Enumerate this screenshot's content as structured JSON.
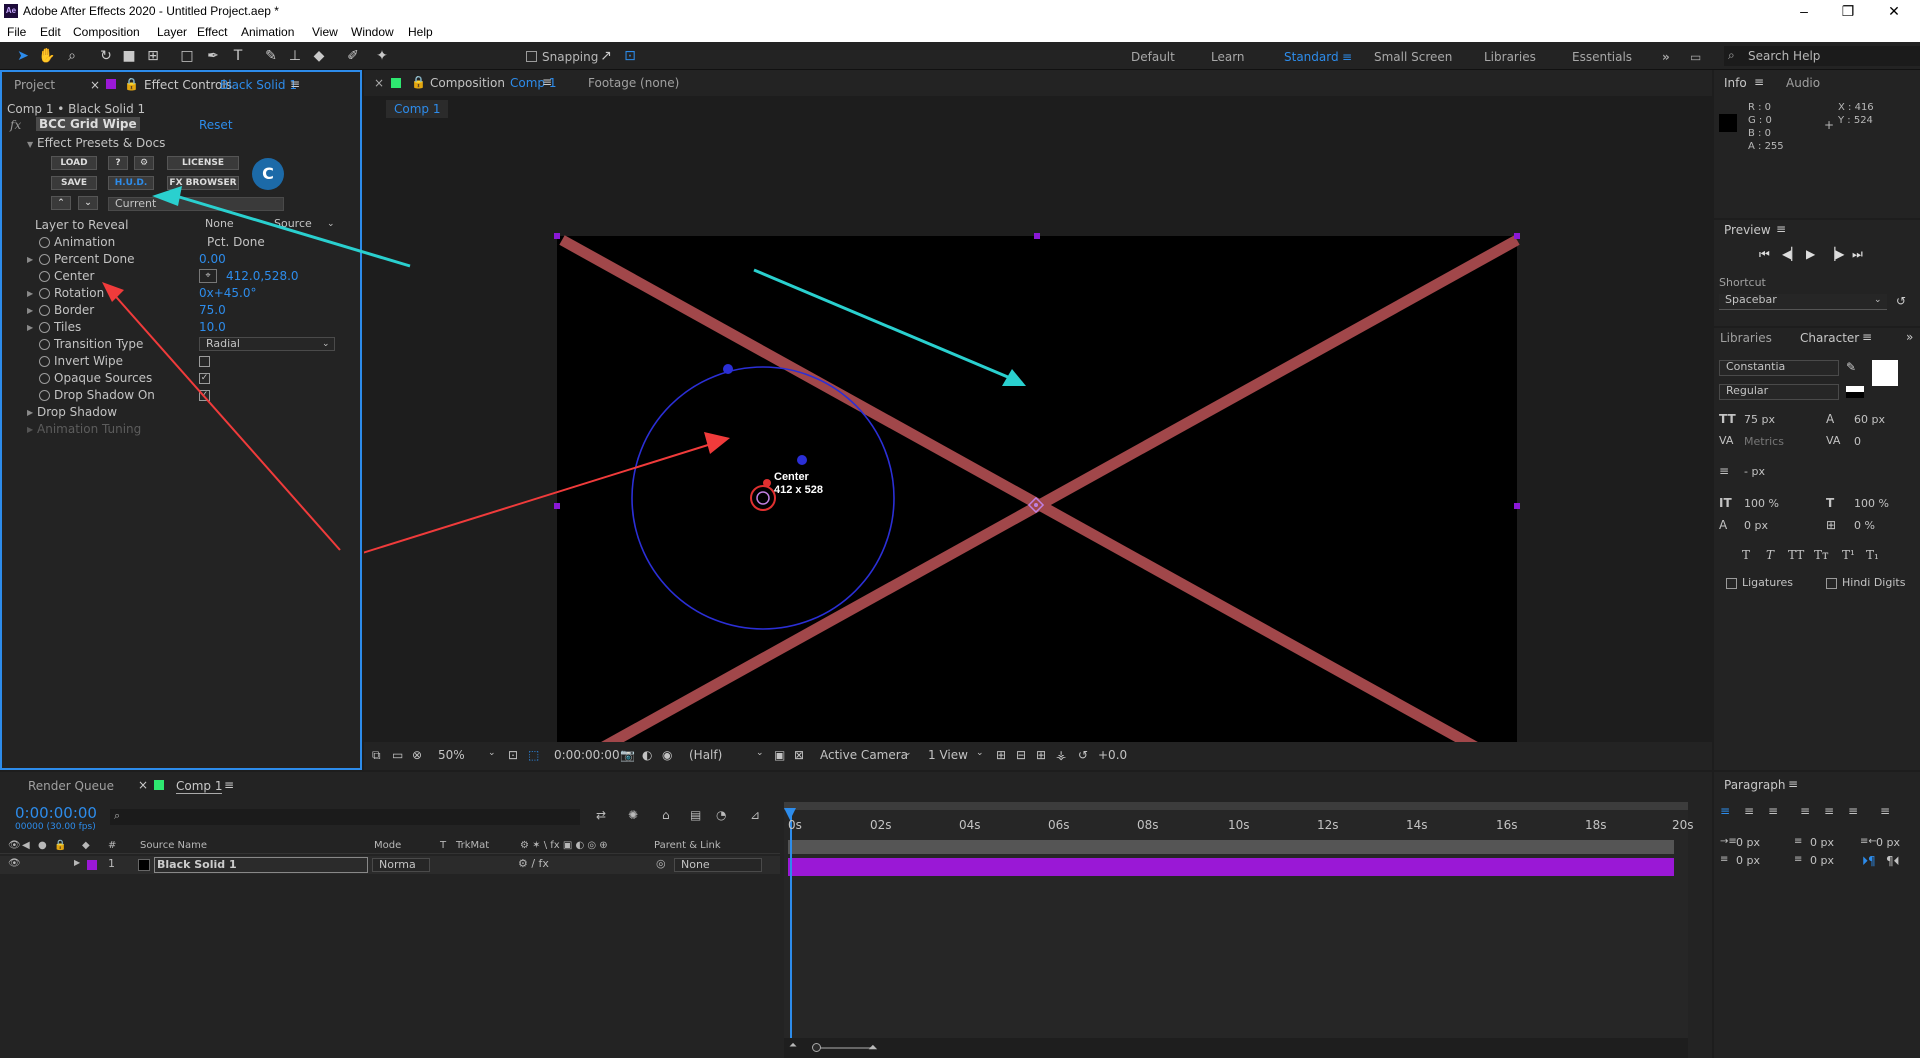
{
  "window": {
    "title": "Adobe After Effects 2020 - Untitled Project.aep *",
    "app_icon": "Ae"
  },
  "menu": [
    "File",
    "Edit",
    "Composition",
    "Layer",
    "Effect",
    "Animation",
    "View",
    "Window",
    "Help"
  ],
  "toolbar": {
    "snapping_label": "Snapping",
    "workspaces": [
      "Default",
      "Learn",
      "Standard",
      "Small Screen",
      "Libraries",
      "Essentials"
    ],
    "active_workspace": "Standard",
    "search_placeholder": "Search Help"
  },
  "project_panel": {
    "tab_project": "Project",
    "tab_effect_controls": "Effect Controls",
    "effect_controls_layer": "Black Solid 1",
    "breadcrumb": "Comp 1 • Black Solid 1",
    "effect_name": "BCC Grid Wipe",
    "reset_label": "Reset",
    "presets_label": "Effect Presets & Docs",
    "buttons": {
      "load": "LOAD",
      "help": "?",
      "license": "LICENSE",
      "save": "SAVE",
      "hud": "H.U.D.",
      "fx_browser": "FX BROWSER",
      "current": "Current",
      "logo": "C"
    },
    "properties": [
      {
        "label": "Layer to Reveal",
        "value": "None",
        "value2": "Source",
        "kind": "dropdown2"
      },
      {
        "label": "Animation",
        "value": "Pct. Done",
        "kind": "dropdown"
      },
      {
        "label": "Percent Done",
        "value": "0.00",
        "kind": "number"
      },
      {
        "label": "Center",
        "value": "412.0,528.0",
        "kind": "point"
      },
      {
        "label": "Rotation",
        "value": "0x+45.0°",
        "kind": "number"
      },
      {
        "label": "Border",
        "value": "75.0",
        "kind": "number"
      },
      {
        "label": "Tiles",
        "value": "10.0",
        "kind": "number"
      },
      {
        "label": "Transition Type",
        "value": "Radial",
        "kind": "dropdown"
      },
      {
        "label": "Invert Wipe",
        "checked": false,
        "kind": "checkbox"
      },
      {
        "label": "Opaque Sources",
        "checked": true,
        "kind": "checkbox"
      },
      {
        "label": "Drop Shadow On",
        "checked": true,
        "kind": "checkbox"
      },
      {
        "label": "Drop Shadow",
        "kind": "group"
      },
      {
        "label": "Animation Tuning",
        "kind": "group-disabled"
      }
    ]
  },
  "composition_panel": {
    "tab_label": "Composition",
    "tab_comp": "Comp 1",
    "footage_label": "Footage (none)",
    "sub_tab": "Comp 1",
    "center_label": "Center",
    "center_value": "412 x 528",
    "viewer_bar": {
      "zoom": "50%",
      "timecode": "0:00:00:00",
      "resolution": "(Half)",
      "camera": "Active Camera",
      "views": "1 View",
      "exposure": "+0.0"
    }
  },
  "info_panel": {
    "tab_info": "Info",
    "tab_audio": "Audio",
    "r": "R : 0",
    "g": "G : 0",
    "b": "B : 0",
    "a": "A : 255",
    "x": "X : 416",
    "y": "Y : 524"
  },
  "preview_panel": {
    "title": "Preview",
    "shortcut_label": "Shortcut",
    "shortcut_value": "Spacebar"
  },
  "character_panel": {
    "tab_libraries": "Libraries",
    "tab_character": "Character",
    "font": "Constantia",
    "style": "Regular",
    "size": "75 px",
    "leading": "60 px",
    "kerning": "Metrics",
    "tracking": "0",
    "stroke": "- px",
    "vscale": "100 %",
    "hscale": "100 %",
    "baseline": "0 px",
    "tsume": "0 %",
    "ligatures": "Ligatures",
    "hindi_digits": "Hindi Digits"
  },
  "paragraph_panel": {
    "title": "Paragraph",
    "indent_left": "0 px",
    "indent_first": "0 px",
    "indent_right": "0 px",
    "space_before": "0 px",
    "space_after": "0 px"
  },
  "timeline": {
    "tab_render_queue": "Render Queue",
    "tab_comp": "Comp 1",
    "timecode": "0:00:00:00",
    "frame_info": "00000 (30.00 fps)",
    "columns": {
      "source_name": "Source Name",
      "mode": "Mode",
      "t": "T",
      "trkmat": "TrkMat",
      "parent": "Parent & Link"
    },
    "layers": [
      {
        "index": "1",
        "name": "Black Solid 1",
        "mode": "Norma",
        "parent": "None"
      }
    ],
    "ruler": [
      "0s",
      "02s",
      "04s",
      "06s",
      "08s",
      "10s",
      "12s",
      "14s",
      "16s",
      "18s",
      "20s"
    ]
  },
  "colors": {
    "accent_blue": "#2d8ceb",
    "layer_bar": "#9a18d6",
    "x_lines": "#a1474a",
    "circle": "#2b2fd6",
    "arrow_red": "#f03b3b",
    "arrow_cyan": "#2ad0cf"
  }
}
